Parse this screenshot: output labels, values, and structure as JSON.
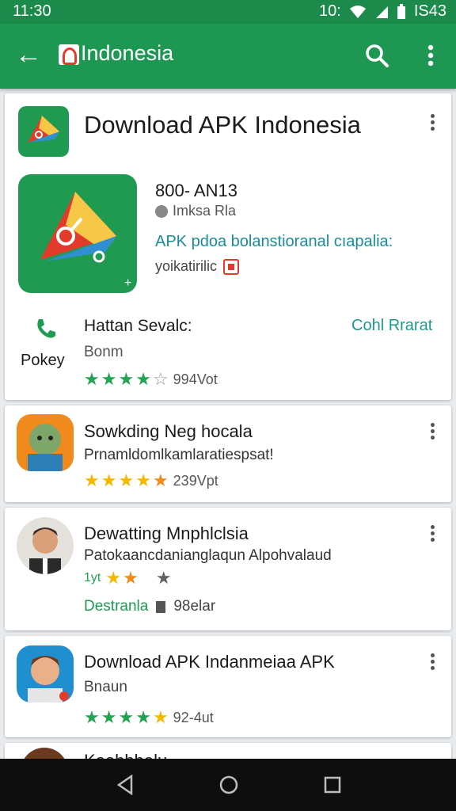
{
  "status": {
    "time": "11:30",
    "battery": "IS43",
    "signal_text": "10:"
  },
  "toolbar": {
    "title": "Indonesia"
  },
  "cards": {
    "main": {
      "title": "Download APK Indonesia",
      "version": "800- AN13",
      "publisher": "Imksa Rla",
      "description_line1": "APK pdoa bolanstioranal cıapalia:",
      "description_line2": "yoikatirilic",
      "call_label": "Hattan Sevalc:",
      "call_action": "Cohl Rrarat",
      "call_sub": "Bonm",
      "phone_caption": "Pokey",
      "rating_count": "994Vot"
    },
    "app2": {
      "title": "Sowkding Neg hocala",
      "subtitle": "Prnamldomlkamlaratiespsat!",
      "rating_count": "239Vpt"
    },
    "app3": {
      "title": "Dewatting Mnphlclsia",
      "subtitle": "Patokaancdanianglaqun Alpohvalaud",
      "rating_prefix": "1yt",
      "tag1": "Destranla",
      "tag2": "98elar"
    },
    "app4": {
      "title": "Download APK Indanmeiaa APK",
      "subtitle": "Bnaun",
      "rating_count": "92-4ut"
    },
    "app5": {
      "title": "Koohbbalu"
    }
  },
  "colors": {
    "primary": "#1d9752",
    "statusbar": "#1b8a4a",
    "accent": "#1a9b8e",
    "star_green": "#22a350",
    "star_yellow": "#f5b800"
  }
}
